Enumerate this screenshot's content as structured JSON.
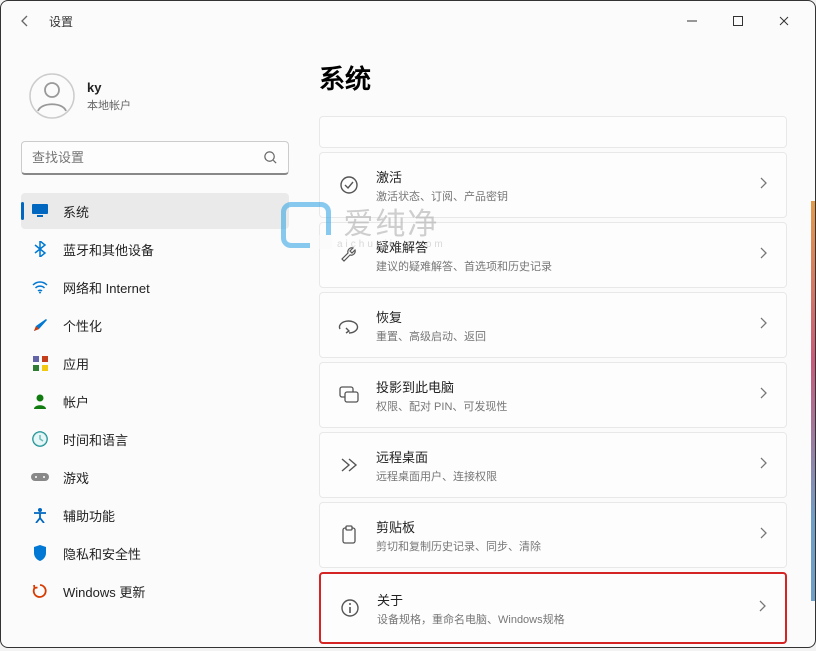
{
  "window": {
    "title": "设置"
  },
  "user": {
    "name": "ky",
    "subtitle": "本地帐户"
  },
  "search": {
    "placeholder": "查找设置"
  },
  "sidebar": {
    "items": [
      {
        "label": "系统",
        "icon": "display"
      },
      {
        "label": "蓝牙和其他设备",
        "icon": "bluetooth"
      },
      {
        "label": "网络和 Internet",
        "icon": "wifi"
      },
      {
        "label": "个性化",
        "icon": "brush"
      },
      {
        "label": "应用",
        "icon": "apps"
      },
      {
        "label": "帐户",
        "icon": "person"
      },
      {
        "label": "时间和语言",
        "icon": "clock"
      },
      {
        "label": "游戏",
        "icon": "game"
      },
      {
        "label": "辅助功能",
        "icon": "accessibility"
      },
      {
        "label": "隐私和安全性",
        "icon": "shield"
      },
      {
        "label": "Windows 更新",
        "icon": "update"
      }
    ],
    "selected": 0
  },
  "page": {
    "title": "系统"
  },
  "cards": [
    {
      "title": "激活",
      "sub": "激活状态、订阅、产品密钥",
      "icon": "check-circle"
    },
    {
      "title": "疑难解答",
      "sub": "建议的疑难解答、首选项和历史记录",
      "icon": "wrench"
    },
    {
      "title": "恢复",
      "sub": "重置、高级启动、返回",
      "icon": "recover"
    },
    {
      "title": "投影到此电脑",
      "sub": "权限、配对 PIN、可发现性",
      "icon": "project"
    },
    {
      "title": "远程桌面",
      "sub": "远程桌面用户、连接权限",
      "icon": "remote"
    },
    {
      "title": "剪贴板",
      "sub": "剪切和复制历史记录、同步、清除",
      "icon": "clipboard"
    },
    {
      "title": "关于",
      "sub": "设备规格，重命名电脑、Windows规格",
      "icon": "info",
      "highlight": true
    }
  ],
  "watermark": {
    "text": "爱纯净",
    "sub": "aichunjing.com"
  }
}
